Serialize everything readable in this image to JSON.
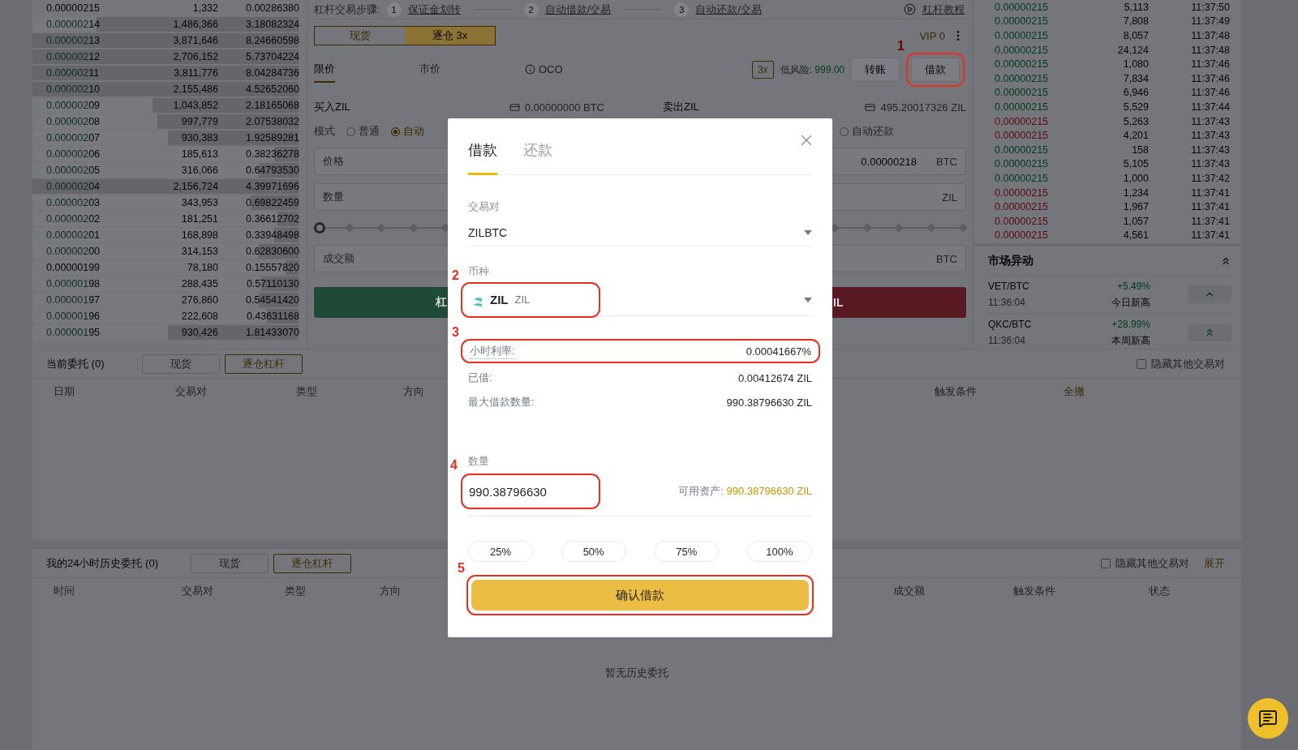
{
  "order_book": {
    "rows": [
      {
        "kind": "plain",
        "price": "0.00000215",
        "amount": "1,332",
        "total": "0.00286380",
        "level": 0
      },
      {
        "kind": "split",
        "price": "0.000002**14**",
        "amount": "1,486,366",
        "total": "3.18082324",
        "level": 0.76
      },
      {
        "kind": "split",
        "price": "0.000002**13**",
        "amount": "3,871,646",
        "total": "8.24660598",
        "level": 1
      },
      {
        "kind": "split",
        "price": "0.000002**12**",
        "amount": "2,706,152",
        "total": "5.73704224",
        "level": 1
      },
      {
        "kind": "split",
        "price": "0.000002**11**",
        "amount": "3,811,776",
        "total": "8.04284736",
        "level": 1
      },
      {
        "kind": "split",
        "price": "0.000002**10**",
        "amount": "2,155,486",
        "total": "4.52652060",
        "level": 1
      },
      {
        "kind": "split",
        "price": "0.000002**09**",
        "amount": "1,043,852",
        "total": "2.18165068",
        "level": 0.55
      },
      {
        "kind": "split",
        "price": "0.000002**08**",
        "amount": "997,779",
        "total": "2.07538032",
        "level": 0.53
      },
      {
        "kind": "split",
        "price": "0.000002**07**",
        "amount": "930,383",
        "total": "1.92589281",
        "level": 0.49
      },
      {
        "kind": "split",
        "price": "0.000002**06**",
        "amount": "185,613",
        "total": "0.38236278",
        "level": 0.09
      },
      {
        "kind": "split",
        "price": "0.000002**05**",
        "amount": "316,066",
        "total": "0.64793530",
        "level": 0.15
      },
      {
        "kind": "split",
        "price": "0.000002**04**",
        "amount": "2,156,724",
        "total": "4.39971696",
        "level": 1
      },
      {
        "kind": "split",
        "price": "0.000002**03**",
        "amount": "343,953",
        "total": "0.69822459",
        "level": 0.18
      },
      {
        "kind": "split",
        "price": "0.000002**02**",
        "amount": "181,251",
        "total": "0.36612702",
        "level": 0.08
      },
      {
        "kind": "split",
        "price": "0.000002**01**",
        "amount": "168,898",
        "total": "0.33948498",
        "level": 0.09
      },
      {
        "kind": "split",
        "price": "0.000002**00**",
        "amount": "314,153",
        "total": "0.62830600",
        "level": 0.15
      },
      {
        "kind": "plain",
        "price": "0.00000199",
        "amount": "78,180",
        "total": "0.15557820",
        "level": 0.05
      },
      {
        "kind": "split",
        "price": "0.000001**98**",
        "amount": "288,435",
        "total": "0.57110130",
        "level": 0.14
      },
      {
        "kind": "split",
        "price": "0.000001**97**",
        "amount": "276,860",
        "total": "0.54541420",
        "level": 0.15
      },
      {
        "kind": "split",
        "price": "0.000001**96**",
        "amount": "222,608",
        "total": "0.43631168",
        "level": 0.12
      },
      {
        "kind": "split",
        "price": "0.000001**95**",
        "amount": "930,426",
        "total": "1.81433070",
        "level": 0.49
      }
    ]
  },
  "steps": {
    "title": "杠杆交易步骤:",
    "items": [
      {
        "number": "1",
        "label": "保证金划转"
      },
      {
        "number": "2",
        "label": "自动借款/交易"
      },
      {
        "number": "3",
        "label": "自动还款/交易"
      }
    ],
    "tutorial": "杠杆教程"
  },
  "account_tabs": [
    {
      "label": "现货",
      "selected": false
    },
    {
      "label": "逐仓 3x",
      "selected": true
    }
  ],
  "vip": "VIP 0",
  "order_types": [
    {
      "label": "限价",
      "selected": true
    },
    {
      "label": "市价",
      "selected": false
    },
    {
      "label": "OCO",
      "selected": false
    }
  ],
  "leverage": "3x",
  "risk": "低风险: **999.00**",
  "transfer_button": "转账",
  "borrow_button": {
    "label": "借款",
    "annotation": "1"
  },
  "buy": {
    "title": "买入ZIL",
    "balance": "0.00000000 BTC",
    "mode_label": "模式",
    "modes": [
      {
        "label": "普通",
        "selected": false
      },
      {
        "label": "自动",
        "selected": true
      }
    ],
    "price_label": "价格",
    "amount_label": "数量",
    "slider": {
      "level": 0
    },
    "total_label": "成交额",
    "button": "杠"
  },
  "sell": {
    "title": "卖出ZIL",
    "balance": "495.20017326 ZIL",
    "modes": [
      {
        "label": "自动还款",
        "selected": false
      }
    ],
    "price": "0.00000218",
    "price_unit": "BTC",
    "amount_unit": "ZIL",
    "total_unit": "BTC",
    "button": "IL"
  },
  "trades": [
    {
      "price": "0.00000215",
      "amount": "5,113",
      "time": "11:37:50",
      "color": "#003a1f"
    },
    {
      "price": "0.00000215",
      "amount": "7,808",
      "time": "11:37:49",
      "color": "#003a1f"
    },
    {
      "price": "0.00000215",
      "amount": "8,057",
      "time": "11:37:48",
      "color": "#003a1f"
    },
    {
      "price": "0.00000215",
      "amount": "24,124",
      "time": "11:37:48",
      "color": "#003a1f"
    },
    {
      "price": "0.00000215",
      "amount": "1,080",
      "time": "11:37:46",
      "color": "#003a1f"
    },
    {
      "price": "0.00000215",
      "amount": "7,834",
      "time": "11:37:46",
      "color": "#003a1f"
    },
    {
      "price": "0.00000215",
      "amount": "6,946",
      "time": "11:37:46",
      "color": "#003a1f"
    },
    {
      "price": "0.00000215",
      "amount": "5,529",
      "time": "11:37:44",
      "color": "#003a1f"
    },
    {
      "price": "0.00000215",
      "amount": "5,263",
      "time": "11:37:43",
      "color": "#5a0a14"
    },
    {
      "price": "0.00000215",
      "amount": "4,201",
      "time": "11:37:43",
      "color": "#5a0a14"
    },
    {
      "price": "0.00000215",
      "amount": "158",
      "time": "11:37:43",
      "color": "#003a1f"
    },
    {
      "price": "0.00000215",
      "amount": "5,105",
      "time": "11:37:43",
      "color": "#003a1f"
    },
    {
      "price": "0.00000215",
      "amount": "1,000",
      "time": "11:37:42",
      "color": "#003a1f"
    },
    {
      "price": "0.00000215",
      "amount": "1,234",
      "time": "11:37:41",
      "color": "#5a0a14"
    },
    {
      "price": "0.00000215",
      "amount": "1,967",
      "time": "11:37:41",
      "color": "#5a0a14"
    },
    {
      "price": "0.00000215",
      "amount": "1,057",
      "time": "11:37:41",
      "color": "#5a0a14"
    },
    {
      "price": "0.00000215",
      "amount": "4,561",
      "time": "11:37:41",
      "color": "#5a0a14"
    }
  ],
  "market_moves": {
    "title": "市场异动",
    "items": [
      {
        "pair": "VET/BTC",
        "change": "+5.49%",
        "time": "11:36:04",
        "note": "今日新高",
        "kind": "single"
      },
      {
        "pair": "QKC/BTC",
        "change": "+28.99%",
        "time": "11:36:04",
        "note": "本周新高",
        "kind": "double"
      }
    ]
  },
  "open_orders": {
    "title": "当前委托 (0)",
    "tabs": [
      {
        "label": "现货",
        "selected": false
      },
      {
        "label": "逐仓杠杆",
        "selected": true
      }
    ],
    "hide_label": "隐藏其他交易对",
    "hide_checked": false,
    "columns": [
      "日期",
      "交易对",
      "类型",
      "方向",
      "触发条件",
      "全撤"
    ]
  },
  "history": {
    "title": "我的24小时历史委托 (0)",
    "tabs": [
      {
        "label": "现货",
        "selected": false
      },
      {
        "label": "逐仓杠杆",
        "selected": true
      }
    ],
    "hide_label": "隐藏其他交易对",
    "hide_checked": false,
    "expand": "展开",
    "columns": [
      "时间",
      "交易对",
      "类型",
      "方向",
      "成交额",
      "触发条件",
      "状态"
    ],
    "empty": "暂无历史委托"
  },
  "modal": {
    "tabs": [
      {
        "label": "借款",
        "selected": true
      },
      {
        "label": "还款",
        "selected": false
      }
    ],
    "pair": {
      "label": "交易对",
      "value": "ZILBTC"
    },
    "coin": {
      "label": "币种",
      "symbol": "ZIL",
      "name": "ZIL",
      "annotation": "2"
    },
    "stats": [
      {
        "label": "小时利率:",
        "value": "0.00041667%",
        "annotation": "3"
      },
      {
        "label": "已借:",
        "value": "0.00412674 ZIL"
      },
      {
        "label": "最大借款数量:",
        "value": "990.38796630 ZIL"
      }
    ],
    "amount": {
      "label": "数量",
      "value": "990.38796630",
      "available": "可用资产: **990.38796630 ZIL**",
      "annotation": "4"
    },
    "percents": [
      "25%",
      "50%",
      "75%",
      "100%"
    ],
    "confirm": {
      "label": "确认借款",
      "annotation": "5"
    }
  }
}
